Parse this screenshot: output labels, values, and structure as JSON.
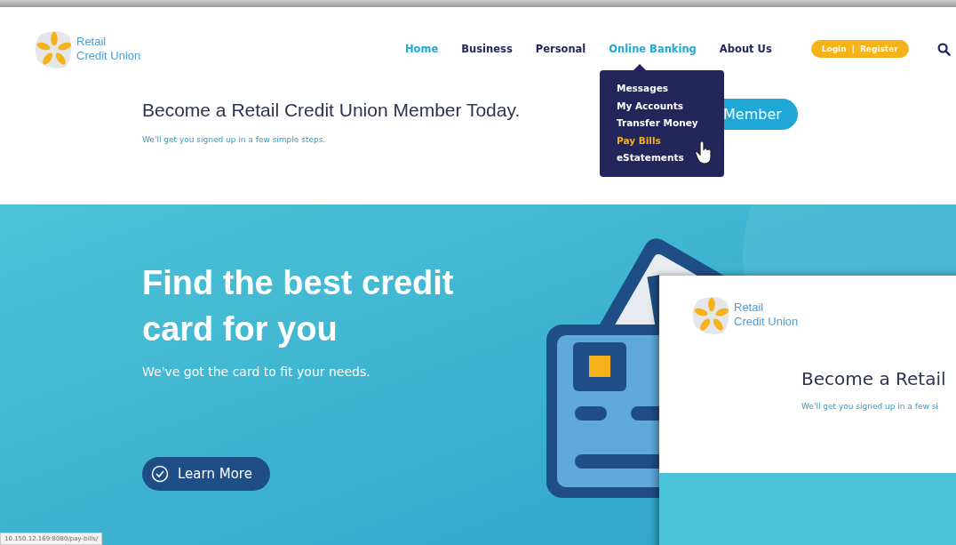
{
  "header": {
    "logo": {
      "line1": "Retail",
      "line2": "Credit Union"
    },
    "nav": [
      {
        "label": "Home",
        "selected": true
      },
      {
        "label": "Business",
        "selected": false
      },
      {
        "label": "Personal",
        "selected": false
      },
      {
        "label": "Online Banking",
        "selected": true
      },
      {
        "label": "About Us",
        "selected": false
      }
    ],
    "login": "Login",
    "register": "Register",
    "separator": "|"
  },
  "dropdown": {
    "items": [
      {
        "label": "Messages",
        "selected": false
      },
      {
        "label": "My Accounts",
        "selected": false
      },
      {
        "label": "Transfer Money",
        "selected": false
      },
      {
        "label": "Pay Bills",
        "selected": true
      },
      {
        "label": "eStatements",
        "selected": false
      }
    ]
  },
  "banner": {
    "title": "Become a Retail Credit Union Member Today.",
    "subtitle": "We'll get you signed up in a few simple steps.",
    "button": "Member"
  },
  "hero": {
    "title": "Find the best credit card for you",
    "subtitle": "We've got the card to fit your needs.",
    "button": "Learn More"
  },
  "preview_window": {
    "logo": {
      "line1": "Retail",
      "line2": "Credit Union"
    },
    "title": "Become a Retail",
    "subtitle": "We'll get you signed up in a few si"
  },
  "status_url": "10.150.12.169:8080/pay-bills/"
}
